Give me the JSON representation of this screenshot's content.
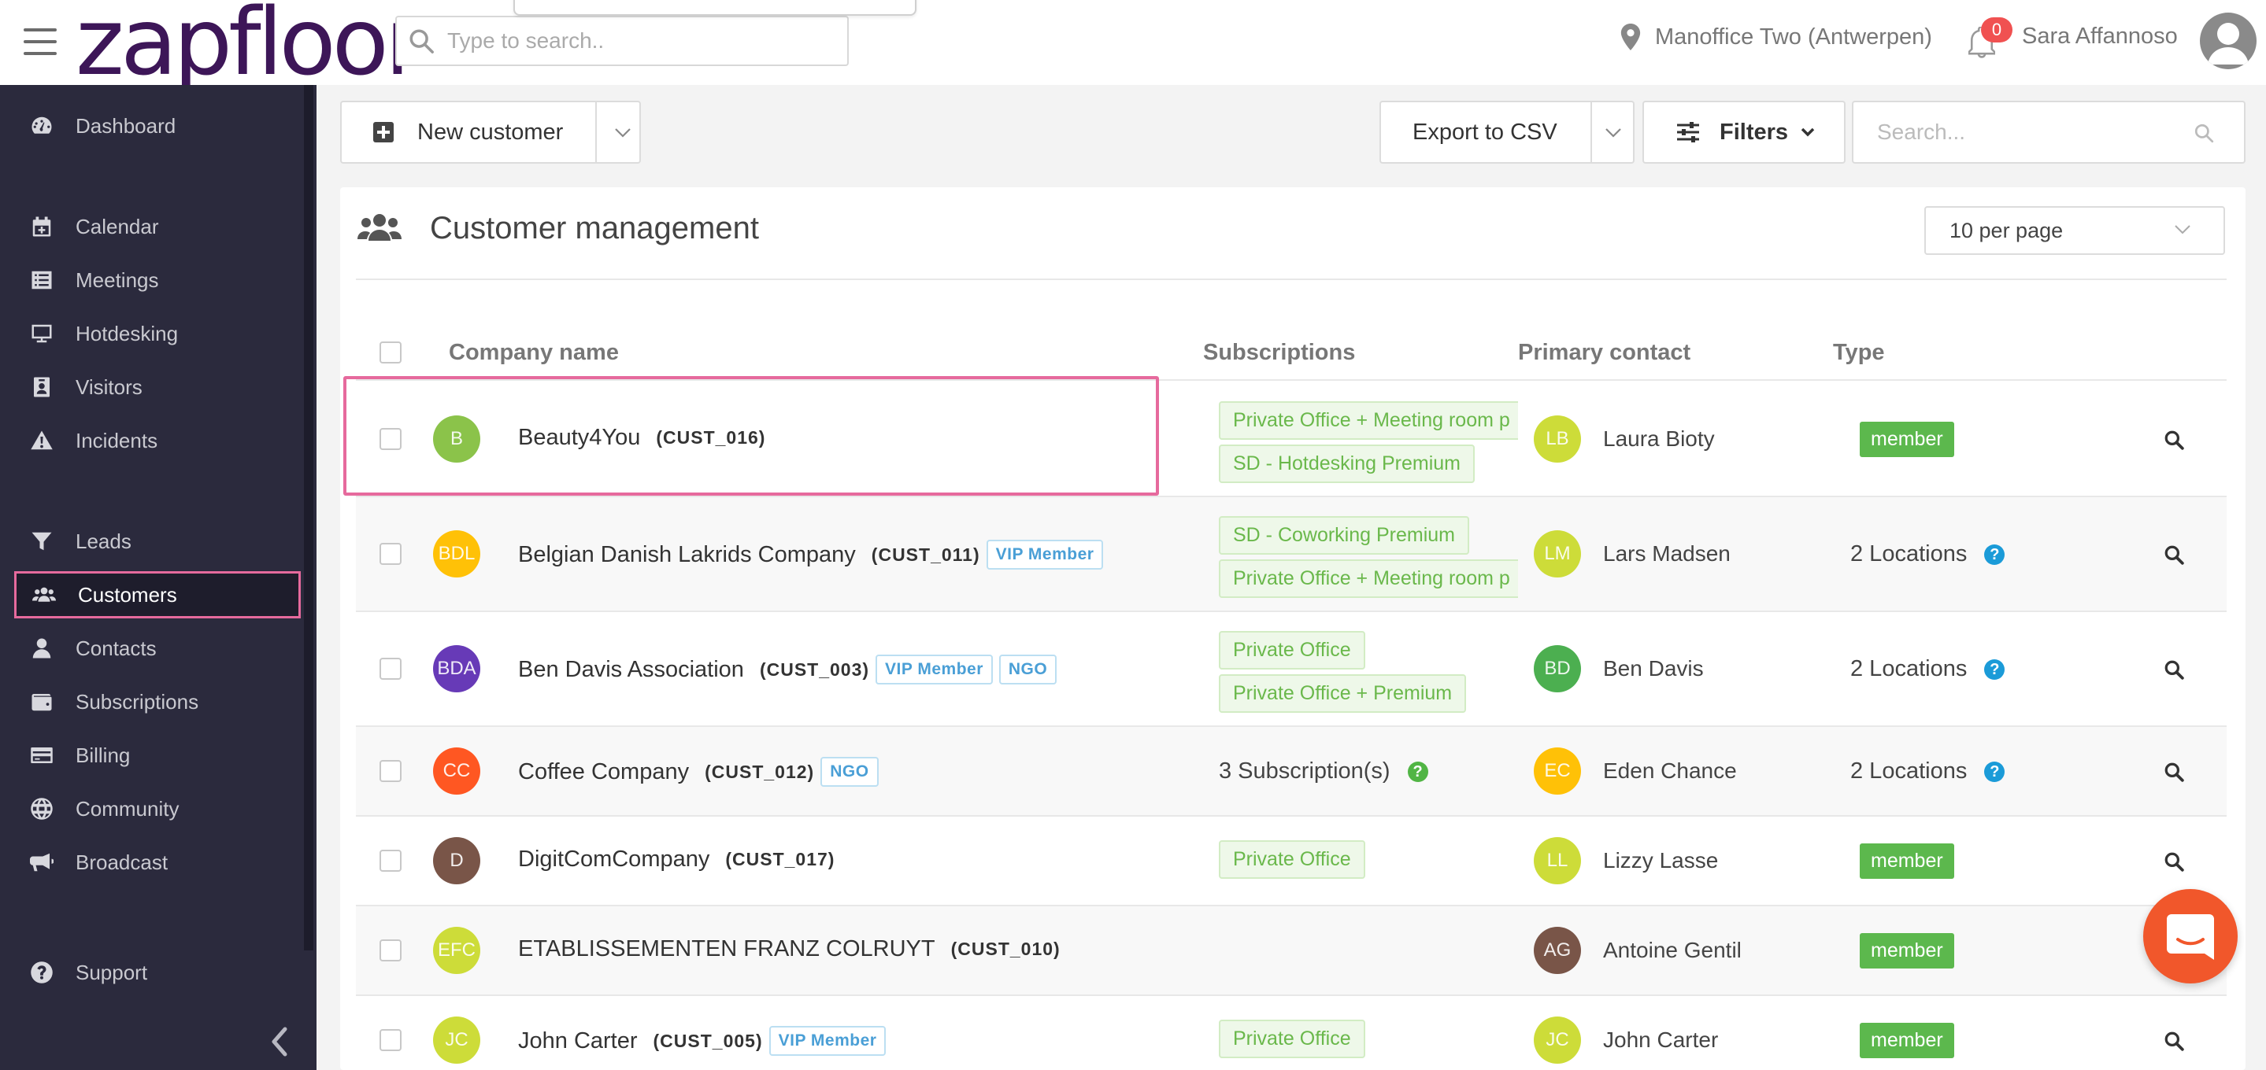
{
  "app": {
    "logo_text": "zapfloor",
    "search_placeholder": "Type to search..",
    "location": "Manoffice Two (Antwerpen)",
    "notifications_count": "0",
    "user_name": "Sara Affannoso"
  },
  "sidebar": {
    "items": [
      {
        "label": "Dashboard",
        "icon": "dashboard-icon"
      },
      {
        "label": "Calendar",
        "icon": "calendar-icon"
      },
      {
        "label": "Meetings",
        "icon": "list-icon"
      },
      {
        "label": "Hotdesking",
        "icon": "monitor-icon"
      },
      {
        "label": "Visitors",
        "icon": "id-badge-icon"
      },
      {
        "label": "Incidents",
        "icon": "warning-icon"
      },
      {
        "label": "Leads",
        "icon": "funnel-icon"
      },
      {
        "label": "Customers",
        "icon": "users-icon"
      },
      {
        "label": "Contacts",
        "icon": "user-icon"
      },
      {
        "label": "Subscriptions",
        "icon": "wallet-icon"
      },
      {
        "label": "Billing",
        "icon": "credit-card-icon"
      },
      {
        "label": "Community",
        "icon": "globe-icon"
      },
      {
        "label": "Broadcast",
        "icon": "megaphone-icon"
      },
      {
        "label": "Support",
        "icon": "question-circle-icon"
      }
    ],
    "active": "Customers"
  },
  "toolbar": {
    "new_customer": "New customer",
    "export_csv": "Export to CSV",
    "filters": "Filters",
    "search_placeholder": "Search..."
  },
  "panel": {
    "title": "Customer management",
    "per_page": "10 per page",
    "columns": {
      "company": "Company name",
      "subscriptions": "Subscriptions",
      "primary_contact": "Primary contact",
      "type": "Type"
    }
  },
  "customers": [
    {
      "initials": "B",
      "avatar_color": "#8bc34a",
      "name": "Beauty4You",
      "code": "(CUST_016)",
      "tags": [],
      "subscriptions": [
        "Private Office + Meeting room p",
        "SD - Hotdesking Premium"
      ],
      "subscriptions_text": "",
      "contact_initials": "LB",
      "contact_color": "#cddc39",
      "contact_name": "Laura Bioty",
      "type_badge": "member",
      "type_text": ""
    },
    {
      "initials": "BDL",
      "avatar_color": "#ffc107",
      "name": "Belgian Danish Lakrids Company",
      "code": "(CUST_011)",
      "tags": [
        "VIP Member"
      ],
      "subscriptions": [
        "SD - Coworking Premium",
        "Private Office + Meeting room p"
      ],
      "subscriptions_text": "",
      "contact_initials": "LM",
      "contact_color": "#cddc39",
      "contact_name": "Lars Madsen",
      "type_badge": "",
      "type_text": "2 Locations"
    },
    {
      "initials": "BDA",
      "avatar_color": "#673ab7",
      "name": "Ben Davis Association",
      "code": "(CUST_003)",
      "tags": [
        "VIP Member",
        "NGO"
      ],
      "subscriptions": [
        "Private Office",
        "Private Office + Premium"
      ],
      "subscriptions_text": "",
      "contact_initials": "BD",
      "contact_color": "#4caf50",
      "contact_name": "Ben Davis",
      "type_badge": "",
      "type_text": "2 Locations"
    },
    {
      "initials": "CC",
      "avatar_color": "#ff5722",
      "name": "Coffee Company",
      "code": "(CUST_012)",
      "tags": [
        "NGO"
      ],
      "subscriptions": [],
      "subscriptions_text": "3 Subscription(s)",
      "contact_initials": "EC",
      "contact_color": "#ffc107",
      "contact_name": "Eden Chance",
      "type_badge": "",
      "type_text": "2 Locations"
    },
    {
      "initials": "D",
      "avatar_color": "#795548",
      "name": "DigitComCompany",
      "code": "(CUST_017)",
      "tags": [],
      "subscriptions": [
        "Private Office"
      ],
      "subscriptions_text": "",
      "contact_initials": "LL",
      "contact_color": "#cddc39",
      "contact_name": "Lizzy Lasse",
      "type_badge": "member",
      "type_text": ""
    },
    {
      "initials": "EFC",
      "avatar_color": "#cddc39",
      "name": "ETABLISSEMENTEN FRANZ COLRUYT",
      "code": "(CUST_010)",
      "tags": [],
      "subscriptions": [],
      "subscriptions_text": "",
      "contact_initials": "AG",
      "contact_color": "#795548",
      "contact_name": "Antoine Gentil",
      "type_badge": "member",
      "type_text": ""
    },
    {
      "initials": "JC",
      "avatar_color": "#cddc39",
      "name": "John Carter",
      "code": "(CUST_005)",
      "tags": [
        "VIP Member"
      ],
      "subscriptions": [
        "Private Office"
      ],
      "subscriptions_text": "",
      "contact_initials": "JC",
      "contact_color": "#cddc39",
      "contact_name": "John Carter",
      "type_badge": "member",
      "type_text": ""
    }
  ],
  "colors": {
    "sidebar_bg": "#2b2a3d",
    "brand": "#3d1658",
    "highlight": "#e66a9d",
    "member_badge": "#5cb84d",
    "chat_button": "#f1572b"
  }
}
